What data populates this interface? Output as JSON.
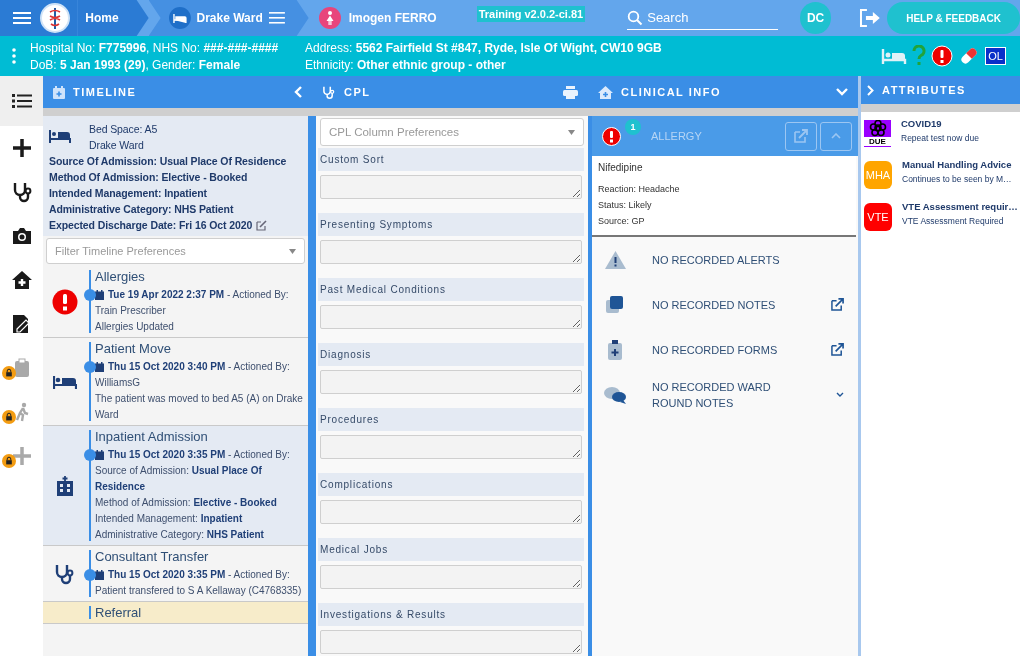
{
  "nav": {
    "home": "Home",
    "ward": "Drake Ward",
    "patient": "Imogen FERRO",
    "version": "Training v2.0.2-ci.81",
    "search_placeholder": "Search",
    "user_initials": "DC",
    "help_button": "HELP & FEEDBACK"
  },
  "patient_bar": {
    "details": [
      "Hospital No: **F775996**, NHS No: **###-###-####**",
      "Address: **5562 Fairfield St #847, Ryde, Isle Of Wight, CW10 9GB**",
      "DoB: **5 Jan 1993 (29)**, Gender: **Female**",
      "Ethnicity: **Other ethnic group - other**"
    ],
    "badge": "OL"
  },
  "rail": [
    {
      "selected": true,
      "locked": false
    },
    {
      "selected": false,
      "locked": false
    },
    {
      "selected": false,
      "locked": false
    },
    {
      "selected": false,
      "locked": false
    },
    {
      "selected": false,
      "locked": false
    },
    {
      "selected": false,
      "locked": false
    },
    {
      "selected": false,
      "locked": true
    },
    {
      "selected": false,
      "locked": true
    },
    {
      "selected": false,
      "locked": true
    }
  ],
  "timeline": {
    "title": "TIMELINE",
    "bed": {
      "space": "Bed Space: A5",
      "ward": "Drake Ward",
      "details": [
        "Source Of Admission: Usual Place Of Residence",
        "Method Of Admission: Elective - Booked",
        "Intended Management: Inpatient",
        "Administrative Category: NHS Patient",
        "Expected Discharge Date: Fri 16 Oct 2020"
      ]
    },
    "filter_placeholder": "Filter Timeline Preferences",
    "entries": [
      {
        "kind": "allergy",
        "title": "Allergies",
        "date": "Tue 19 Apr 2022 2:37 PM",
        "actioned": "- Actioned By:",
        "lines": [
          "Train Prescriber",
          "Allergies Updated"
        ]
      },
      {
        "kind": "move",
        "title": "Patient Move",
        "date": "Thu 15 Oct 2020 3:40 PM",
        "actioned": "- Actioned By:",
        "lines": [
          "WilliamsG",
          "The patient was moved to bed A5 (A) on Drake Ward"
        ]
      },
      {
        "kind": "admission",
        "title": "Inpatient Admission",
        "date": "Thu 15 Oct 2020 3:35 PM",
        "actioned": "- Actioned By:",
        "lines": [
          "Source of Admission: **Usual Place Of Residence**",
          "Method of Admission: **Elective - Booked**",
          "Intended Management: **Inpatient**",
          "Administrative Category: **NHS Patient**"
        ]
      },
      {
        "kind": "transfer",
        "title": "Consultant Transfer",
        "date": "Thu 15 Oct 2020 3:35 PM",
        "actioned": "- Actioned By:",
        "lines": [
          "Patient transfered to S A Kellaway (C4768335)"
        ]
      },
      {
        "kind": "referral",
        "title": "Referral"
      }
    ]
  },
  "cpl": {
    "title": "CPL",
    "preferences_placeholder": "CPL Column Preferences",
    "sections": [
      "Custom Sort",
      "Presenting Symptoms",
      "Past Medical Conditions",
      "Diagnosis",
      "Procedures",
      "Complications",
      "Medical Jobs",
      "Investigations & Results"
    ]
  },
  "clinical": {
    "title": "CLINICAL INFO",
    "allergy": {
      "label": "ALLERGY",
      "count": "1",
      "name": "Nifedipine",
      "details": [
        "Reaction: Headache",
        "Status: Likely",
        "Source: GP"
      ]
    },
    "rows": [
      {
        "kind": "alerts",
        "text": "NO RECORDED ALERTS",
        "has_link": false,
        "expandable": false
      },
      {
        "kind": "notes",
        "text": "NO RECORDED NOTES",
        "has_link": true,
        "expandable": false
      },
      {
        "kind": "forms",
        "text": "NO RECORDED FORMS",
        "has_link": true,
        "expandable": false
      },
      {
        "kind": "ward_round",
        "text": "NO RECORDED WARD ROUND NOTES",
        "has_link": false,
        "expandable": true
      }
    ]
  },
  "attributes": {
    "title": "ATTRIBUTES",
    "items": [
      {
        "kind": "covid",
        "badge": "DUE",
        "color": "#9900ff",
        "title": "COVID19",
        "text": "Repeat test now due"
      },
      {
        "kind": "text",
        "badge": "MHA",
        "color": "#ffa500",
        "title": "Manual Handling Advice",
        "text": "Continues to be seen by M…"
      },
      {
        "kind": "text",
        "badge": "VTE",
        "color": "#ff0000",
        "title": "VTE Assessment requir…",
        "text": "VTE Assessment Required"
      }
    ]
  }
}
